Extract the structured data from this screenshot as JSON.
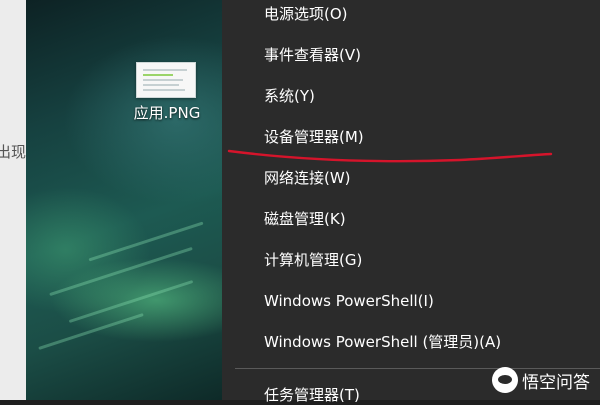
{
  "left_panel": {
    "clipped_text": "出现"
  },
  "desktop": {
    "file_name": "应用.PNG"
  },
  "context_menu": {
    "items": [
      {
        "label": "电源选项(O)"
      },
      {
        "label": "事件查看器(V)"
      },
      {
        "label": "系统(Y)"
      },
      {
        "label": "设备管理器(M)"
      },
      {
        "label": "网络连接(W)"
      },
      {
        "label": "磁盘管理(K)"
      },
      {
        "label": "计算机管理(G)"
      },
      {
        "label": "Windows PowerShell(I)"
      },
      {
        "label": "Windows PowerShell (管理员)(A)"
      },
      {
        "label": "任务管理器(T)"
      }
    ]
  },
  "annotation": {
    "color": "#d5142b"
  },
  "watermark": {
    "text": "悟空问答",
    "icon": "wukong-logo-icon"
  }
}
